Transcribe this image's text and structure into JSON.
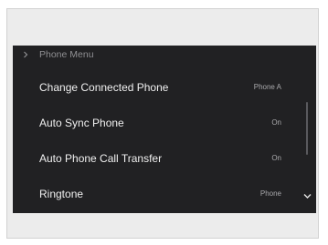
{
  "header": {
    "title": "Phone Menu",
    "icon": "chevron-right-icon"
  },
  "menu": {
    "items": [
      {
        "label": "Change Connected Phone",
        "value": "Phone A"
      },
      {
        "label": "Auto Sync Phone",
        "value": "On"
      },
      {
        "label": "Auto Phone Call Transfer",
        "value": "On"
      },
      {
        "label": "Ringtone",
        "value": "Phone"
      }
    ]
  },
  "scroll": {
    "down_icon": "chevron-down-icon"
  },
  "colors": {
    "screen_bg": "#212123",
    "text": "#f0f0f0",
    "muted_text": "#8f8f92"
  }
}
